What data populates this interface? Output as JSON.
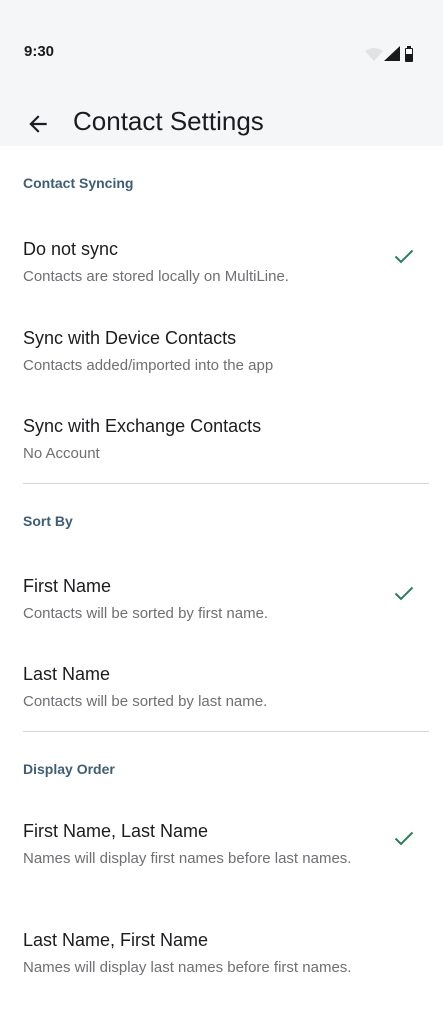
{
  "status_bar": {
    "time": "9:30"
  },
  "header": {
    "title": "Contact Settings"
  },
  "colors": {
    "accent": "#2e7d5b",
    "section": "#3f5e74"
  },
  "sections": [
    {
      "title": "Contact Syncing",
      "items": [
        {
          "title": "Do not sync",
          "subtitle": "Contacts are stored locally on MultiLine.",
          "selected": true
        },
        {
          "title": "Sync with Device Contacts",
          "subtitle": "Contacts added/imported into the app",
          "selected": false
        },
        {
          "title": "Sync with Exchange Contacts",
          "subtitle": "No Account",
          "selected": false
        }
      ]
    },
    {
      "title": "Sort By",
      "items": [
        {
          "title": "First Name",
          "subtitle": "Contacts will be sorted by first name.",
          "selected": true
        },
        {
          "title": "Last Name",
          "subtitle": "Contacts will be sorted by last name.",
          "selected": false
        }
      ]
    },
    {
      "title": "Display Order",
      "items": [
        {
          "title": "First Name, Last Name",
          "subtitle": "Names will display first names before last names.",
          "selected": true
        },
        {
          "title": "Last Name, First Name",
          "subtitle": "Names will display last names before first names.",
          "selected": false
        }
      ]
    }
  ]
}
